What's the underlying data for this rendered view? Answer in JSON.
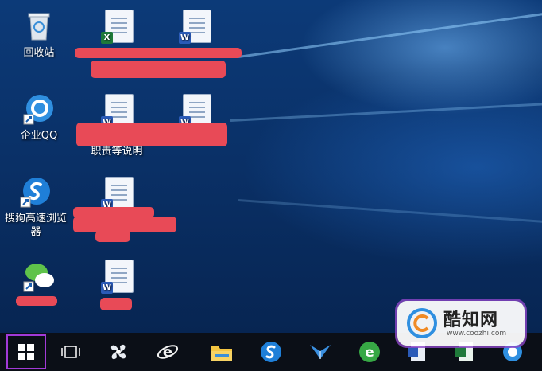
{
  "desktop": {
    "icons": [
      {
        "label": "回收站"
      },
      {
        "label": "企业QQ"
      },
      {
        "label": "搜狗高速浏览器"
      },
      {
        "label": "职责等说明"
      }
    ]
  },
  "watermark": {
    "title": "酷知网",
    "url": "www.coozhi.com"
  },
  "colors": {
    "start_highlight": "#a23ad8",
    "redaction": "#e84a57",
    "taskbar": "#0b0f17"
  }
}
